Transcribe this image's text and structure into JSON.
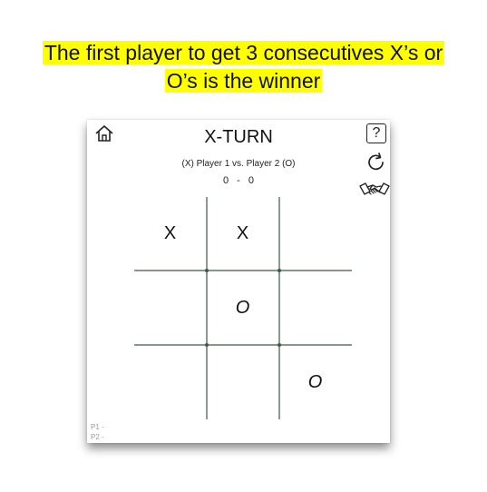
{
  "headline": {
    "line1": "The first player to get 3 consecutives X’s or",
    "line2": "O’s is the winner"
  },
  "game": {
    "title": "X-TURN",
    "players_label": "(X) Player 1 vs. Player 2 (O)",
    "score": "0 - 0",
    "help_label": "?",
    "board": [
      [
        "X",
        "X",
        ""
      ],
      [
        "",
        "O",
        ""
      ],
      [
        "",
        "",
        "O"
      ]
    ],
    "p1_label": "P1 -",
    "p2_label": "P2 -"
  },
  "icons": {
    "home": "home-icon",
    "help": "help-icon",
    "restart": "restart-icon",
    "handshake": "handshake-icon"
  },
  "colors": {
    "highlight": "#ffff00",
    "grid": "#3c5a48"
  }
}
